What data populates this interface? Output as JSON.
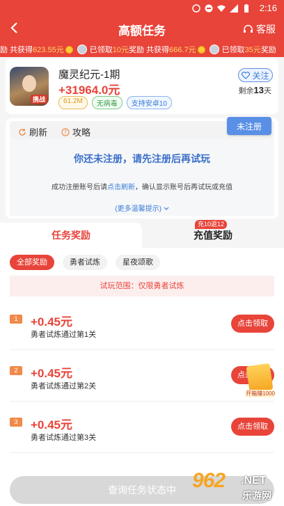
{
  "status_bar": {
    "time": "2:16"
  },
  "header": {
    "title": "高额任务",
    "service_label": "客服"
  },
  "ticker": {
    "segments": [
      {
        "pre": "励",
        "mid": "共获得",
        "amount": "623.55元"
      },
      {
        "pre": "已领取",
        "amount": "10元",
        "post": "奖励",
        "mid": "共获得",
        "amount2": "666.7元"
      },
      {
        "pre": "已领取",
        "amount": "35元",
        "post": "奖励"
      }
    ]
  },
  "game": {
    "name": "魔灵纪元-1期",
    "amount": "+31964.0元",
    "icon_badge": "携战",
    "tags": [
      "61.2M",
      "无病毒",
      "支持安卓10"
    ],
    "follow_label": "关注",
    "remain_prefix": "剩余",
    "remain_days": "13",
    "remain_suffix": "天"
  },
  "register": {
    "refresh_label": "刷新",
    "guide_label": "攻略",
    "status_badge": "未注册",
    "message": "你还未注册，请先注册后再试玩",
    "tip_pre": "成功注册账号后请",
    "tip_link": "点击刷新",
    "tip_post": "，确认显示账号后再试玩或充值",
    "more": "(更多温馨提示)"
  },
  "tabs": {
    "task_reward": "任务奖励",
    "recharge_reward": "充值奖励",
    "recharge_promo": "充10返12"
  },
  "filters": [
    "全部奖励",
    "勇者试炼",
    "星夜颂歌"
  ],
  "scope_text": "试玩范围：仅限勇者试炼",
  "tasks": [
    {
      "num": "1",
      "amount": "+0.45元",
      "desc": "勇者试炼通过第1关",
      "button": "点击领取"
    },
    {
      "num": "2",
      "amount": "+0.45元",
      "desc": "勇者试炼通过第2关",
      "button": "点击领取"
    },
    {
      "num": "3",
      "amount": "+0.45元",
      "desc": "勇者试炼通过第3关",
      "button": "点击领取"
    }
  ],
  "float_ad_label": "开箱赚1000",
  "bottom_button": "查询任务状态中",
  "watermark": {
    "number": "962",
    "net": ".NET",
    "cn": "乐游网"
  },
  "colors": {
    "primary": "#e8443a",
    "link": "#3a7dd9",
    "register_badge": "#5a8fe6"
  }
}
